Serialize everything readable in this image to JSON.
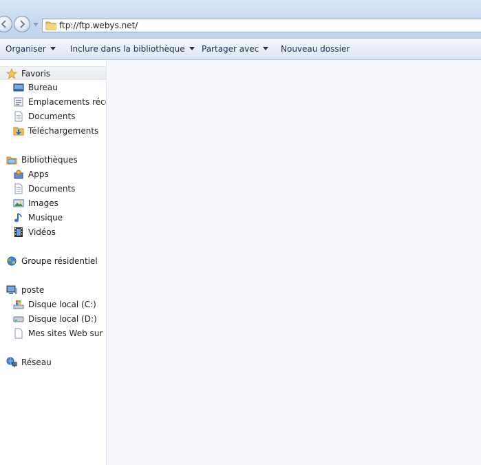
{
  "address": {
    "path": "ftp://ftp.webys.net/"
  },
  "toolbar": {
    "organise": "Organiser",
    "include_library": "Inclure dans la bibliothèque",
    "share_with": "Partager avec",
    "new_folder": "Nouveau dossier"
  },
  "nav": {
    "favorites": {
      "label": "Favoris",
      "items": [
        "Bureau",
        "Emplacements récents",
        "Documents",
        "Téléchargements"
      ]
    },
    "libraries": {
      "label": "Bibliothèques",
      "items": [
        "Apps",
        "Documents",
        "Images",
        "Musique",
        "Vidéos"
      ]
    },
    "homegroup": {
      "label": "Groupe résidentiel"
    },
    "computer": {
      "label": "poste",
      "items": [
        "Disque local (C:)",
        "Disque local (D:)",
        "Mes sites Web sur MSN"
      ]
    },
    "network": {
      "label": "Réseau"
    }
  },
  "colors": {
    "accent": "#1e2f4a",
    "selection": "#e8ebf0",
    "pane_bg": "#ffffff"
  }
}
